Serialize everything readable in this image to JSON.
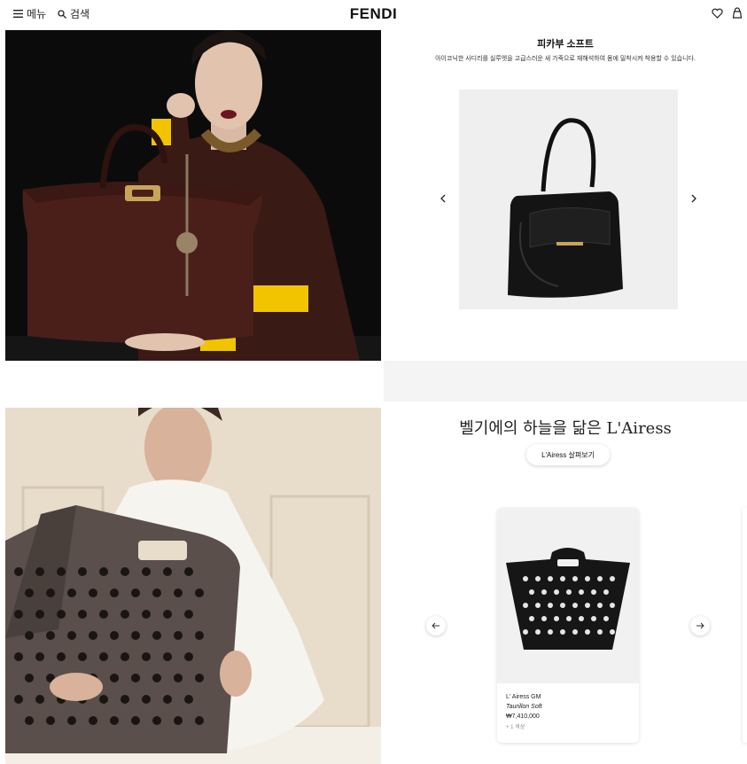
{
  "header": {
    "menu_label": "메뉴",
    "search_label": "검색",
    "logo": "FENDI"
  },
  "section1": {
    "title": "피카부 소프트",
    "description": "아이코닉한 사디리를 실루엣을 고급스러운 새 가죽으로 재해석하여 몸에 밀착시켜 착용할 수 있습니다."
  },
  "section2": {
    "title": "벨기에의 하늘을 닮은 L'Airess",
    "cta": "L'Airess 살펴보기",
    "product": {
      "name": "L' Airess GM",
      "material": "Taurillon Soft",
      "price": "₩7,410,000",
      "colors": "+ 1 색상"
    }
  },
  "colors": {
    "accent_yellow": "#f2c400",
    "bag_burgundy": "#4a1f1a"
  }
}
